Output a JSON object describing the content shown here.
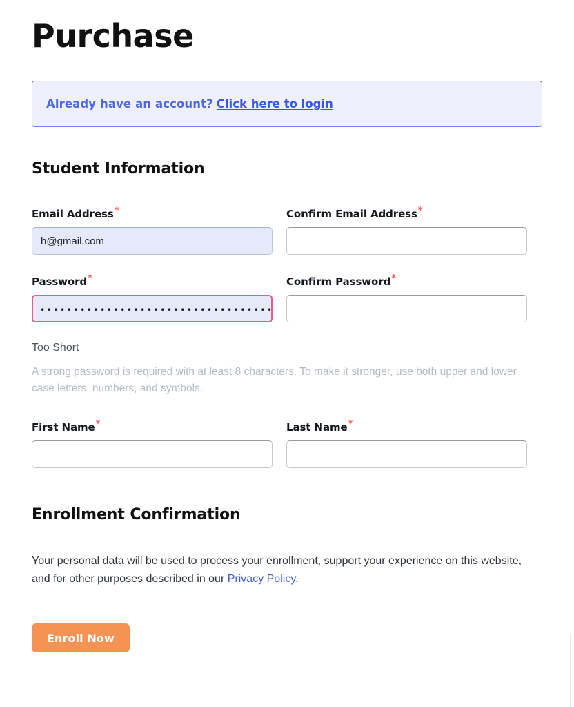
{
  "page": {
    "title": "Purchase"
  },
  "login_notice": {
    "prompt": "Already have an account?",
    "link_label": "Click here to login",
    "border_color": "#6f87ef",
    "background_color": "#eef1fd",
    "text_color": "#4e68e0"
  },
  "sections": {
    "student_information": "Student Information",
    "enrollment_confirmation": "Enrollment Confirmation"
  },
  "required_marker": "*",
  "fields": {
    "email": {
      "label": "Email Address",
      "value": "h@gmail.com",
      "placeholder": "",
      "state": "autofilled"
    },
    "confirm_email": {
      "label": "Confirm Email Address",
      "value": "",
      "placeholder": "",
      "state": "empty"
    },
    "password": {
      "label": "Password",
      "value": "••••••••••••••••••••••••••••••••••••••••••••••••••••••",
      "placeholder": "",
      "state": "error"
    },
    "confirm_password": {
      "label": "Confirm Password",
      "value": "",
      "placeholder": "",
      "state": "empty"
    },
    "first_name": {
      "label": "First Name",
      "value": "",
      "placeholder": "",
      "state": "empty"
    },
    "last_name": {
      "label": "Last Name",
      "value": "",
      "placeholder": "",
      "state": "empty"
    }
  },
  "password_feedback": {
    "strength": "Too Short",
    "hint": "A strong password is required with at least 8 characters. To make it stronger, use both upper and lower case letters, numbers, and symbols.",
    "error_color": "#ef5b84"
  },
  "consent": {
    "before_link": "Your personal data will be used to process your enrollment, support your experience on this website, and for other purposes described in our ",
    "link_label": "Privacy Policy",
    "after_link": "."
  },
  "submit": {
    "label": "Enroll Now",
    "background_color": "#f59354",
    "text_color": "#ffffff"
  }
}
